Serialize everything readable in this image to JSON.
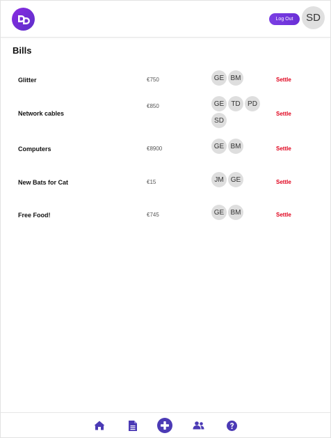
{
  "header": {
    "logo_text": "DD",
    "logout_label": "Log Out",
    "user_initials": "SD"
  },
  "page": {
    "title": "Bills"
  },
  "bills": [
    {
      "name": "Glitter",
      "amount": "€750",
      "members": [
        "GE",
        "BM"
      ],
      "action": "Settle"
    },
    {
      "name": "Network cables",
      "amount": "€850",
      "members": [
        "GE",
        "TD",
        "PD",
        "SD"
      ],
      "action": "Settle"
    },
    {
      "name": "Computers",
      "amount": "€8900",
      "members": [
        "GE",
        "BM"
      ],
      "action": "Settle"
    },
    {
      "name": "New Bats for Cat",
      "amount": "€15",
      "members": [
        "JM",
        "GE"
      ],
      "action": "Settle"
    },
    {
      "name": "Free Food!",
      "amount": "€745",
      "members": [
        "GE",
        "BM"
      ],
      "action": "Settle"
    }
  ],
  "nav": {
    "items": [
      {
        "icon": "home-icon"
      },
      {
        "icon": "document-icon"
      },
      {
        "icon": "plus-circle-icon"
      },
      {
        "icon": "users-icon"
      },
      {
        "icon": "question-circle-icon"
      }
    ]
  },
  "colors": {
    "brand_purple": "#5b2fc9",
    "accent_purple": "#7b3fe4",
    "settle_red": "#e0001b",
    "avatar_gray": "#dedede",
    "nav_icon": "#4b3ab5"
  }
}
